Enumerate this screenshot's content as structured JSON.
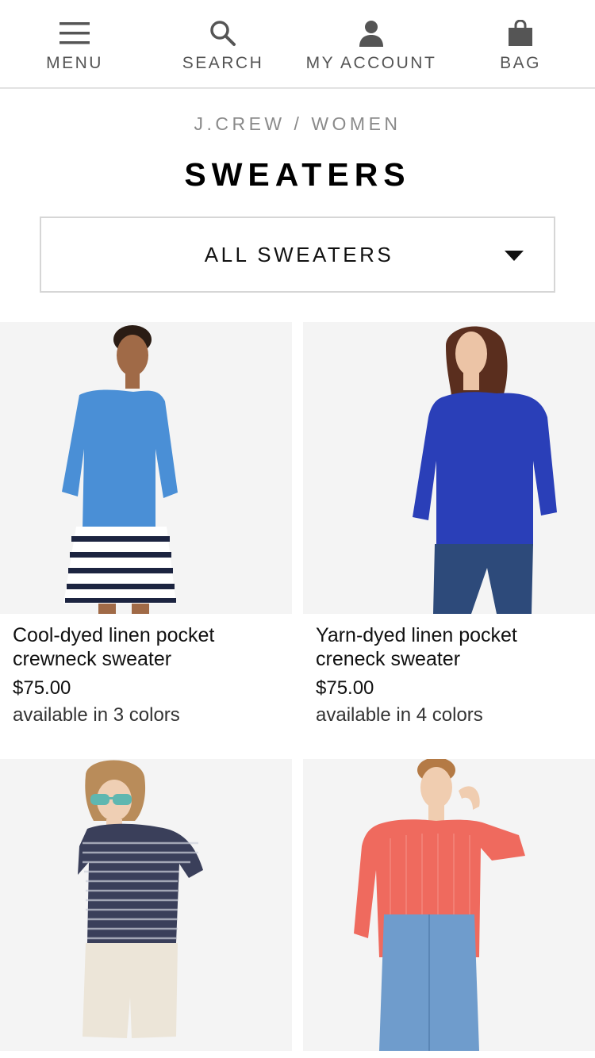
{
  "nav": {
    "menu_label": "MENU",
    "search_label": "SEARCH",
    "account_label": "MY ACCOUNT",
    "bag_label": "BAG",
    "icons": [
      "hamburger-menu-icon",
      "search-icon",
      "user-icon",
      "shopping-bag-icon"
    ]
  },
  "breadcrumb": {
    "brand": "J.CREW",
    "separator": " / ",
    "section": "WOMEN"
  },
  "page": {
    "title": "SWEATERS"
  },
  "filter": {
    "selected": "ALL SWEATERS",
    "icon": "caret-down-icon"
  },
  "colors": {
    "nav_text": "#555555",
    "breadcrumb": "#8a8a8a",
    "image_bg": "#f3f3f3"
  },
  "products": [
    {
      "name": "Cool-dyed linen pocket crewneck sweater",
      "price": "$75.00",
      "colors_text": "available in 3 colors",
      "garment_color": "#4a8fd6"
    },
    {
      "name": "Yarn-dyed linen pocket creneck sweater",
      "price": "$75.00",
      "colors_text": "available in 4 colors",
      "garment_color": "#2a3fb8"
    },
    {
      "name": "",
      "price": "",
      "colors_text": "",
      "garment_color": "#3a3f5a"
    },
    {
      "name": "",
      "price": "",
      "colors_text": "",
      "garment_color": "#ef6a5e"
    }
  ]
}
